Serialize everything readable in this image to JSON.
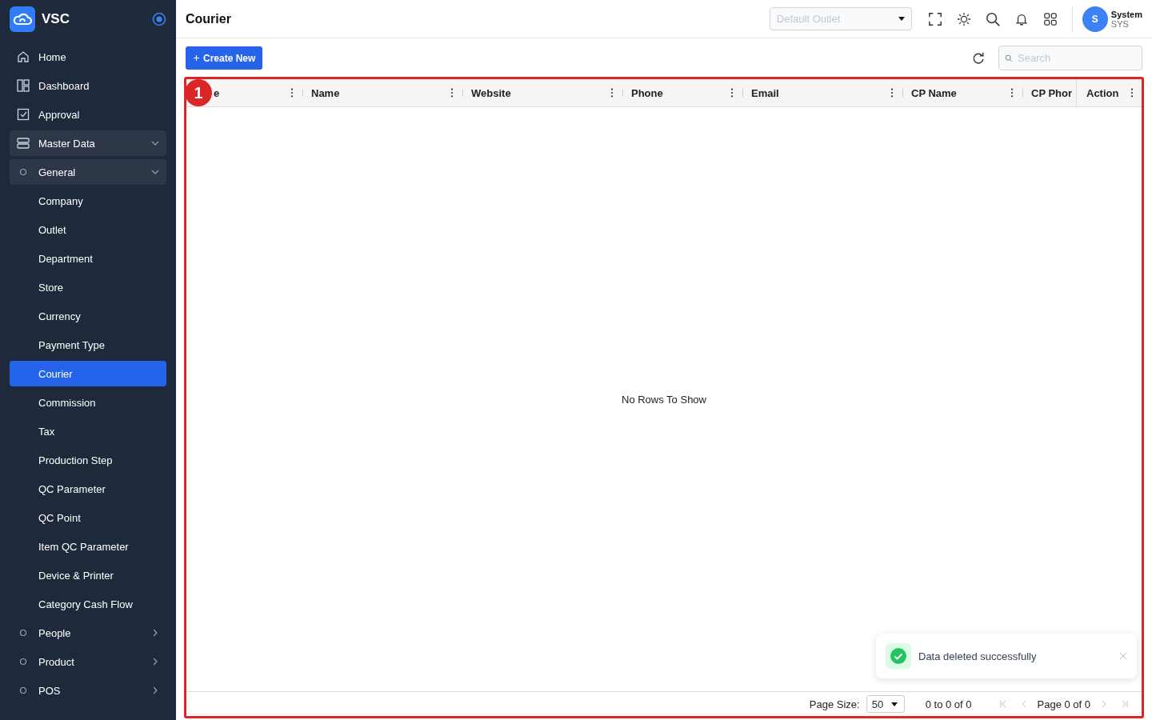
{
  "brand": {
    "name": "VSC"
  },
  "sidebar": {
    "items": [
      {
        "label": "Home",
        "kind": "top",
        "selected": false
      },
      {
        "label": "Dashboard",
        "kind": "top",
        "selected": false
      },
      {
        "label": "Approval",
        "kind": "top",
        "selected": false
      },
      {
        "label": "Master Data",
        "kind": "group",
        "expanded": true
      },
      {
        "label": "General",
        "kind": "section",
        "expanded": true
      },
      {
        "label": "Company",
        "kind": "leaf",
        "selected": false
      },
      {
        "label": "Outlet",
        "kind": "leaf",
        "selected": false
      },
      {
        "label": "Department",
        "kind": "leaf",
        "selected": false
      },
      {
        "label": "Store",
        "kind": "leaf",
        "selected": false
      },
      {
        "label": "Currency",
        "kind": "leaf",
        "selected": false
      },
      {
        "label": "Payment Type",
        "kind": "leaf",
        "selected": false
      },
      {
        "label": "Courier",
        "kind": "leaf",
        "selected": true
      },
      {
        "label": "Commission",
        "kind": "leaf",
        "selected": false
      },
      {
        "label": "Tax",
        "kind": "leaf",
        "selected": false
      },
      {
        "label": "Production Step",
        "kind": "leaf",
        "selected": false
      },
      {
        "label": "QC Parameter",
        "kind": "leaf",
        "selected": false
      },
      {
        "label": "QC Point",
        "kind": "leaf",
        "selected": false
      },
      {
        "label": "Item QC Parameter",
        "kind": "leaf",
        "selected": false
      },
      {
        "label": "Device & Printer",
        "kind": "leaf",
        "selected": false
      },
      {
        "label": "Category Cash Flow",
        "kind": "leaf",
        "selected": false
      },
      {
        "label": "People",
        "kind": "section",
        "expanded": false
      },
      {
        "label": "Product",
        "kind": "section",
        "expanded": false
      },
      {
        "label": "POS",
        "kind": "section",
        "expanded": false
      }
    ]
  },
  "header": {
    "title": "Courier",
    "outlet_select": {
      "placeholder": "Default Outlet"
    },
    "user": {
      "initial": "S",
      "name": "System",
      "code": "SYS"
    }
  },
  "toolbar": {
    "create_button": "Create New",
    "search": {
      "placeholder": "Search"
    }
  },
  "table": {
    "columns": [
      "e",
      "Name",
      "Website",
      "Phone",
      "Email",
      "CP Name",
      "CP Phor"
    ],
    "pinned_column": "Action",
    "empty_message": "No Rows To Show",
    "pagination": {
      "page_size_label": "Page Size:",
      "page_size": "50",
      "range": "0 to 0 of 0",
      "page": "Page 0 of 0"
    }
  },
  "annotation": {
    "number": "1"
  },
  "toast": {
    "message": "Data deleted successfully"
  }
}
